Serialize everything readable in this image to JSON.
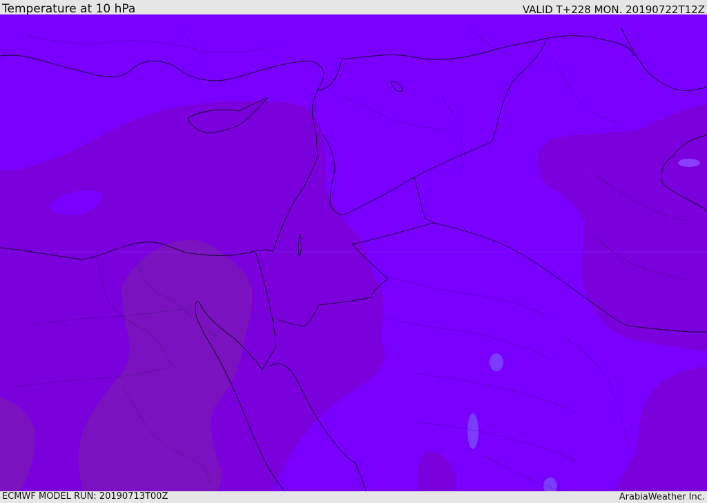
{
  "header": {
    "title": "Temperature at 10 hPa",
    "valid_time": "VALID T+228 MON. 20190722T12Z"
  },
  "footer": {
    "model_run": "ECMWF MODEL RUN: 20190713T00Z",
    "credit": "ArabiaWeather Inc."
  },
  "map": {
    "field": "temperature",
    "pressure_level_hPa": 10,
    "colors": {
      "base_violet": "#7900ff",
      "dark_violet": "#7a00dc",
      "darker_violet": "#7a13bf",
      "pale_blue_spot": "#7a3cff",
      "coastline": "#1a0a3a"
    }
  }
}
